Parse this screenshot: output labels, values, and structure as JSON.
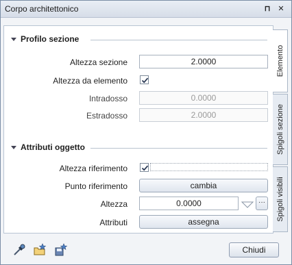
{
  "window": {
    "title": "Corpo architettonico",
    "pin_glyph": "⊓",
    "close_glyph": "✕"
  },
  "sections": {
    "profilo": {
      "title": "Profilo sezione",
      "altezza_sezione": {
        "label": "Altezza sezione",
        "value": "2.0000"
      },
      "altezza_da_elemento": {
        "label": "Altezza da elemento",
        "checked": true
      },
      "intradosso": {
        "label": "Intradosso",
        "value": "0.0000"
      },
      "estradosso": {
        "label": "Estradosso",
        "value": "2.0000"
      }
    },
    "attributi": {
      "title": "Attributi oggetto",
      "altezza_riferimento": {
        "label": "Altezza riferimento",
        "checked": true
      },
      "punto_riferimento": {
        "label": "Punto riferimento",
        "button": "cambia"
      },
      "altezza": {
        "label": "Altezza",
        "value": "0.0000",
        "more": "···"
      },
      "attributi": {
        "label": "Attributi",
        "button": "assegna"
      }
    }
  },
  "tabs": [
    "Elemento",
    "Spigoli sezione",
    "Spigoli visibili"
  ],
  "footer": {
    "icons": [
      "eyedropper-icon",
      "open-favorite-icon",
      "save-favorite-icon"
    ],
    "close_label": "Chiudi"
  }
}
